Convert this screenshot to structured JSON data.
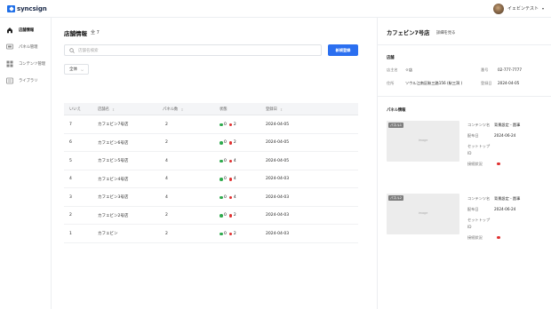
{
  "app": {
    "logo_text": "syncsign",
    "user_name": "イェビンテスト",
    "user_caret": "▾"
  },
  "sidebar": {
    "items": [
      {
        "label": "店舗情報",
        "icon": "home-icon",
        "active": true
      },
      {
        "label": "パネル管理",
        "icon": "panel-icon",
        "active": false
      },
      {
        "label": "コンテンツ管理",
        "icon": "grid-icon",
        "active": false
      },
      {
        "label": "ライブラリ",
        "icon": "library-icon",
        "active": false
      }
    ]
  },
  "main": {
    "title": "店舗情報",
    "count": "全 7",
    "search_placeholder": "店舗名検索",
    "new_button": "新規登録",
    "filter_label": "全体",
    "filter_caret": "⌵",
    "columns": [
      {
        "label": "いいえ",
        "sortable": false
      },
      {
        "label": "店舗名",
        "sortable": true
      },
      {
        "label": "パネル数",
        "sortable": true
      },
      {
        "label": "状態",
        "sortable": false
      },
      {
        "label": "登録日",
        "sortable": true
      }
    ],
    "sort_glyph": "⇕",
    "rows": [
      {
        "no": "7",
        "name": "カフェビン7号店",
        "panels": "2",
        "green": "0",
        "red": "2",
        "date": "2024-04-05"
      },
      {
        "no": "6",
        "name": "カフェビン6号店",
        "panels": "2",
        "green": "0",
        "red": "2",
        "date": "2024-04-05"
      },
      {
        "no": "5",
        "name": "カフェビン5号店",
        "panels": "4",
        "green": "0",
        "red": "4",
        "date": "2024-04-05"
      },
      {
        "no": "4",
        "name": "カフェビン4号店",
        "panels": "4",
        "green": "0",
        "red": "4",
        "date": "2024-04-03"
      },
      {
        "no": "3",
        "name": "カフェビン3号店",
        "panels": "4",
        "green": "0",
        "red": "4",
        "date": "2024-04-03"
      },
      {
        "no": "2",
        "name": "カフェビン2号店",
        "panels": "2",
        "green": "0",
        "red": "2",
        "date": "2024-04-03"
      },
      {
        "no": "1",
        "name": "カフェビン",
        "panels": "2",
        "green": "0",
        "red": "2",
        "date": "2024-04-03"
      }
    ]
  },
  "detail": {
    "title": "カフェビン7号店",
    "detail_link": "詳細を見る",
    "store_section": "店舗",
    "owner_label": "店主名",
    "owner_value": "ㅇ店",
    "phone_label": "番号",
    "phone_value": "02-777-7777",
    "address_label": "住所",
    "address_value": "ソウル江南区駅三路156 (駅三洞 )",
    "reg_label": "登録日",
    "reg_value": "2024-04-05",
    "panel_section": "パネル情報",
    "panels": [
      {
        "tag": "パネル1",
        "thumb_text": "image",
        "content_label": "コンテンツ名",
        "content_value": "背景設定 - 園事",
        "dist_label": "配布日",
        "dist_value": "2024-06-24",
        "settop_label": "セットトップ",
        "settop_id": "ID",
        "conn_label": "接続状況"
      },
      {
        "tag": "パネル2",
        "thumb_text": "image",
        "content_label": "コンテンツ名",
        "content_value": "背景設定 - 園事",
        "dist_label": "配布日",
        "dist_value": "2024-06-24",
        "settop_label": "セットトップ",
        "settop_id": "ID",
        "conn_label": "接続状況"
      }
    ]
  },
  "colors": {
    "accent": "#2b6ff0",
    "status_on": "#2faa4d",
    "status_off": "#e03131"
  }
}
